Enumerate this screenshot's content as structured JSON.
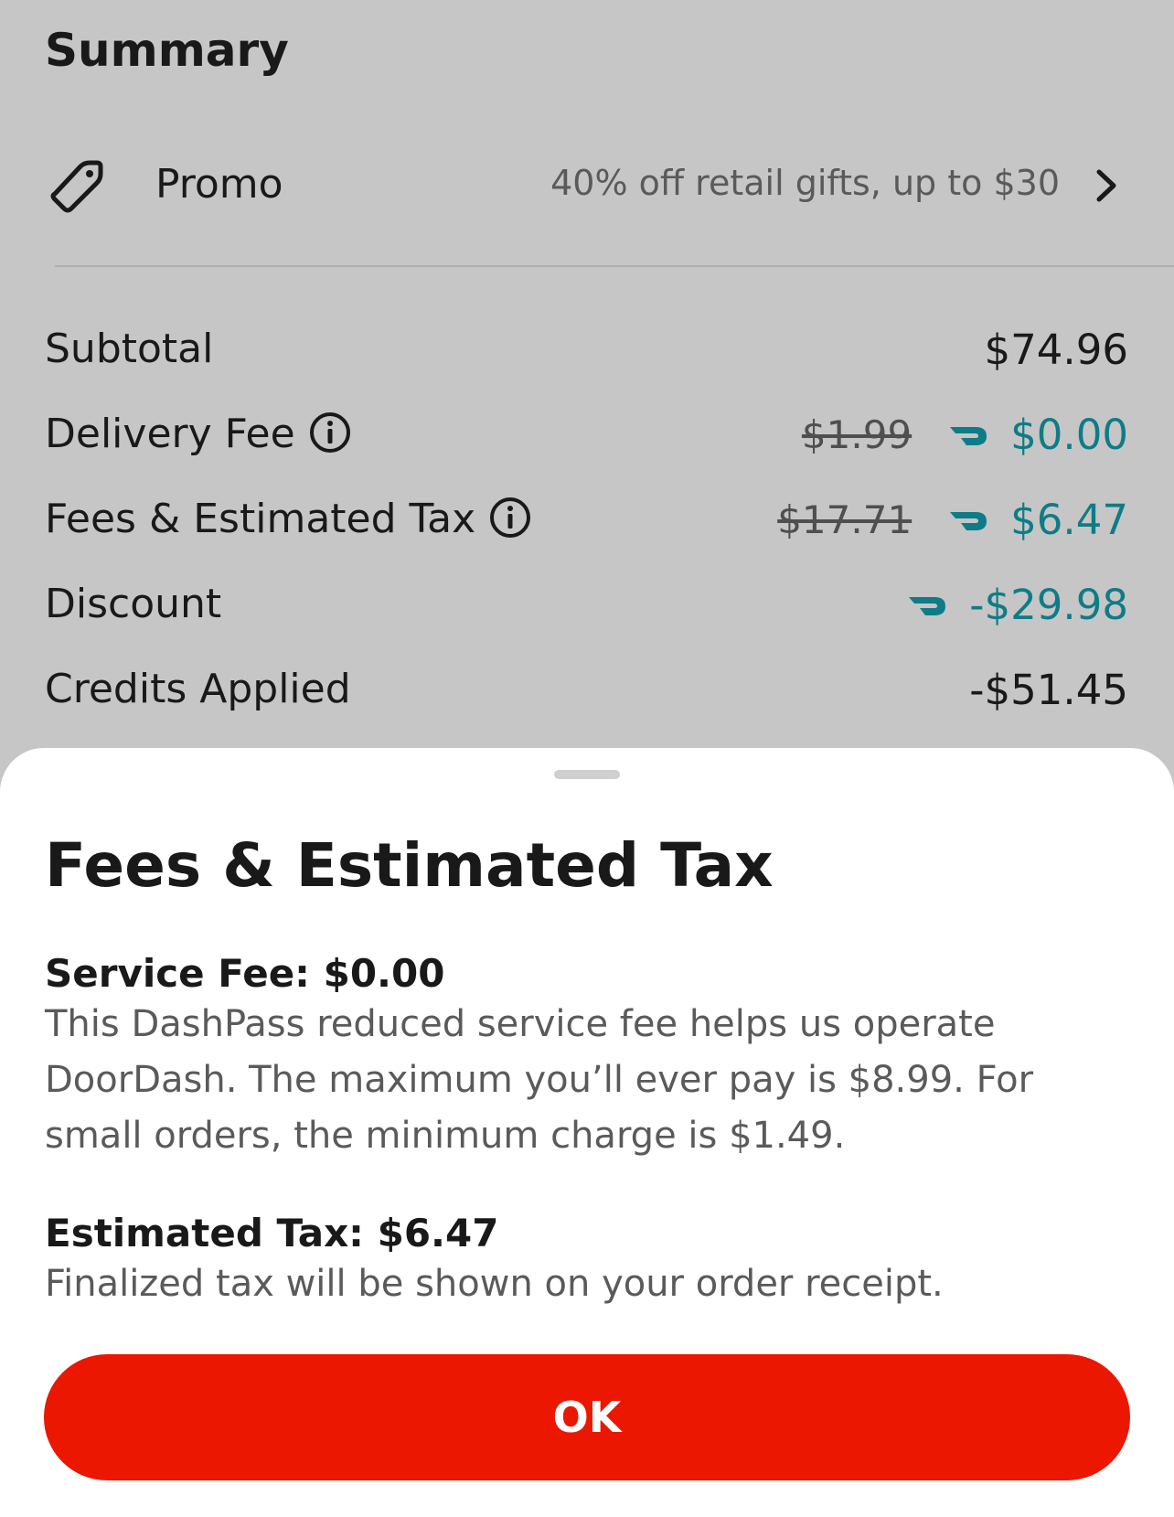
{
  "summary": {
    "title": "Summary",
    "promo": {
      "label": "Promo",
      "value": "40% off retail gifts, up to $30",
      "icon": "tag-icon",
      "chevron_icon": "chevron-right-icon"
    },
    "rows": {
      "subtotal": {
        "label": "Subtotal",
        "value": "$74.96"
      },
      "delivery_fee": {
        "label": "Delivery Fee",
        "original": "$1.99",
        "value": "$0.00"
      },
      "fees_tax": {
        "label": "Fees & Estimated Tax",
        "original": "$17.71",
        "value": "$6.47"
      },
      "discount": {
        "label": "Discount",
        "value": "-$29.98"
      },
      "credits": {
        "label": "Credits Applied",
        "value": "-$51.45"
      }
    }
  },
  "sheet": {
    "title": "Fees & Estimated Tax",
    "service_fee": {
      "heading": "Service Fee: $0.00",
      "body": "This DashPass reduced service fee helps us operate DoorDash. The maximum you’ll ever pay is $8.99. For small orders, the minimum charge is $1.49."
    },
    "estimated_tax": {
      "heading": "Estimated Tax: $6.47",
      "body": "Finalized tax will be shown on your order receipt."
    },
    "ok_label": "OK"
  },
  "colors": {
    "accent_red": "#eb1700",
    "dashpass_teal": "#0e7c86",
    "backdrop": "#c6c6c6"
  }
}
